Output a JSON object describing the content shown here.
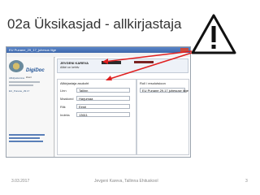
{
  "slide": {
    "title": "02a Üksikasjad - allkirjastaja",
    "footer_date": "3.03.2017",
    "footer_author": "Jevgeni Kareva, Tallinna Ehituskool",
    "page_number": "3"
  },
  "app": {
    "window_title": "EU Punane_29_17_juhesus liige",
    "brand": "DigiDoc",
    "brand_sub": "klient"
  },
  "sidebar": {
    "section_label": "Allkirjastamine",
    "file_label": "EU_Punane_29.17"
  },
  "signer": {
    "name": "JEVGENI KAREVA",
    "status": "Allkiri on kehtiv",
    "validity": "Allkiri on kehtiv"
  },
  "tabs": [
    "Allkirjastaja",
    "Allkiri"
  ],
  "details": {
    "section_title": "Allkirjastaja asukoht",
    "fields": [
      {
        "label": "Linn",
        "value": "Tallinn"
      },
      {
        "label": "Maakond",
        "value": "Harjumaa"
      },
      {
        "label": "Riik",
        "value": "Eesti"
      },
      {
        "label": "Indeks",
        "value": "13611"
      }
    ],
    "role_title": "Roll / resolutsioon",
    "role_value": "EU Punane 29.17 juhesuse liige"
  },
  "colors": {
    "arrow": "#e02020",
    "warning_fill": "#ffffff",
    "warning_stroke": "#111111",
    "titlebar": "#3d67ab"
  }
}
